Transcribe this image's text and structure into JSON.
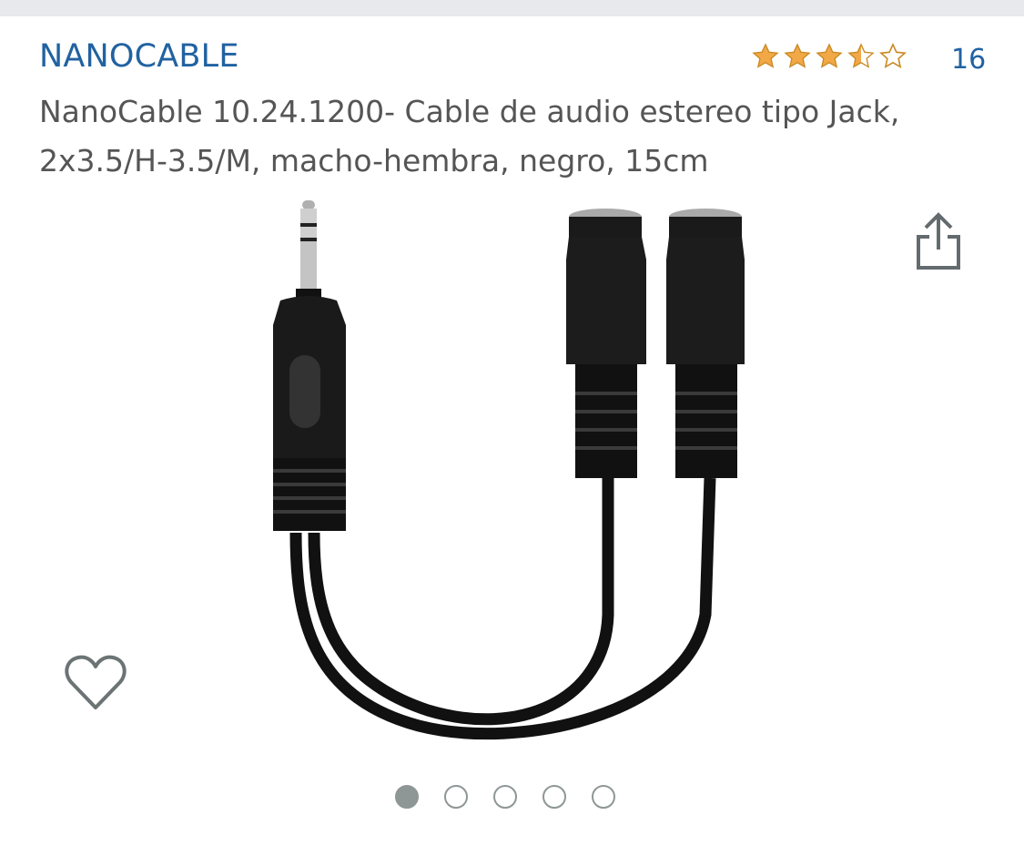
{
  "product": {
    "brand": "NANOCABLE",
    "rating": 3.5,
    "rating_max": 5,
    "rating_count": "16",
    "title": "NanoCable 10.24.1200- Cable de audio estereo tipo Jack, 2x3.5/H-3.5/M, macho-hembra, negro, 15cm"
  },
  "gallery": {
    "image_count": 5,
    "active_index": 0
  },
  "icons": {
    "share": "share-icon",
    "wishlist": "heart-icon"
  },
  "colors": {
    "link_blue": "#2162a1",
    "star_gold": "#f3a847",
    "text_gray": "#555555",
    "price_red": "#b12704"
  }
}
